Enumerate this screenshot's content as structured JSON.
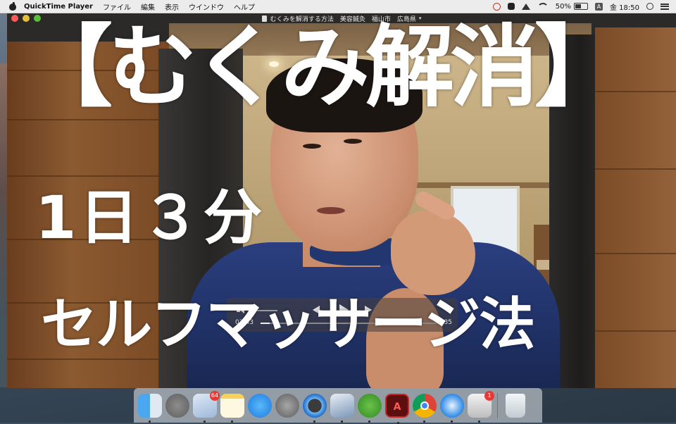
{
  "menubar": {
    "app_name": "QuickTime Player",
    "menus": [
      "ファイル",
      "編集",
      "表示",
      "ウインドウ",
      "ヘルプ"
    ],
    "battery": "50%",
    "input_source": "A",
    "clock": "金 18:50"
  },
  "window": {
    "title": "むくみを解消する方法　美容鍼灸　福山市　広島県"
  },
  "overlay": {
    "title": "【むくみ解消】",
    "subtitle1": "1日３分",
    "subtitle2": "セルフマッサージ法"
  },
  "controller": {
    "elapsed": "02:43",
    "remaining": "35",
    "progress": 0.05
  },
  "dock": {
    "mail_badge": "64",
    "printer_badge": "1",
    "acrobat_glyph": "A"
  }
}
